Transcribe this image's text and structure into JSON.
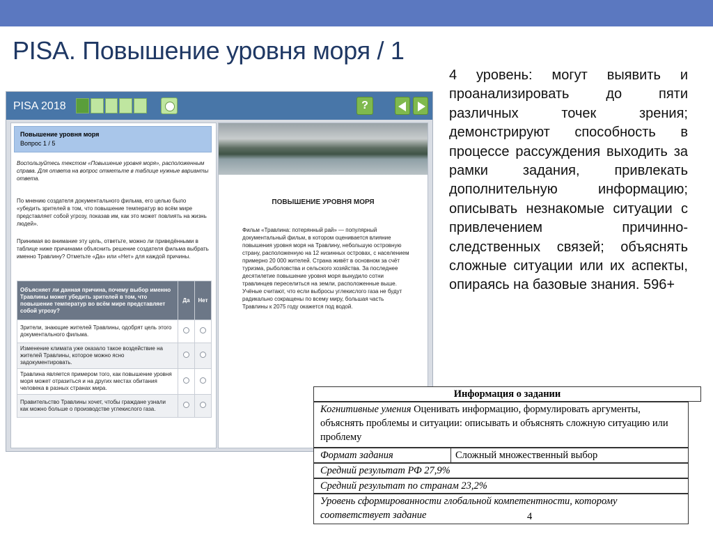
{
  "slide": {
    "title": "PISA. Повышение уровня моря / 1",
    "description": "4 уровень: могут выявить и проанализировать до пяти различных точек зрения; демонстрируют способность в процессе рассуждения выходить за рамки задания, привлекать дополнительную информацию; описывать незнакомые ситуации с привлечением причинно-следственных связей; объяснять  сложные ситуации или их аспекты, опираясь на базовые знания. 596+"
  },
  "pisa": {
    "logo": "PISA 2018",
    "help_label": "?",
    "progress": {
      "total": 5,
      "current": 1
    },
    "question_title": "Повышение уровня моря",
    "question_number": "Вопрос 1 / 5",
    "instruction": "Воспользуйтесь текстом «Повышение уровня моря», расположенным справа. Для ответа на вопрос отметьте в таблице нужные варианты ответа.",
    "paragraph1": "По мнению создателя документального фильма, его целью было «убедить зрителей в том, что повышение температур во всём мире представляет собой угрозу, показав им, как это может повлиять на жизнь людей».",
    "paragraph2": "Принимая во внимание эту цель, ответьте, можно ли приведёнными в таблице ниже причинами объяснить решение создателя фильма выбрать именно Травлину? Отметьте «Да» или «Нет» для каждой причины.",
    "table": {
      "header": "Объясняет ли данная причина, почему выбор именно Травлины может убедить зрителей в том, что повышение температур во всём мире представляет собой угрозу?",
      "col_yes": "Да",
      "col_no": "Нет",
      "rows": [
        "Зрители, знающие жителей Травлины, одобрят цель этого документального фильма.",
        "Изменение климата уже оказало такое воздействие на жителей Травлины, которое можно ясно задокументировать.",
        "Травлина является примером того, как повышение уровня моря может отразиться и на других местах обитания человека в разных странах мира.",
        "Правительство Травлины хочет, чтобы граждане узнали как можно больше о производстве углекислого газа."
      ]
    },
    "article_title": "ПОВЫШЕНИЕ УРОВНЯ МОРЯ",
    "article_text": "Фильм «Травлина: потерянный рай» — популярный документальный фильм, в котором оценивается влияние повышения уровня моря на Травлину, небольшую островную страну, расположенную на 12 низинных островах, с населением примерно 20 000 жителей. Страна живёт в основном за счёт туризма, рыболовства и сельского хозяйства. За последнее десятилетие повышение уровня моря вынудило сотни травлинцев переселиться на земли, расположенные выше. Учёные считают, что если выбросы углекислого газа не будут радикально сокращены по всему миру, большая часть Травлины к 2075 году окажется под водой."
  },
  "info": {
    "heading": "Информация о задании",
    "cognitive_label": "Когнитивные умения",
    "cognitive_value": " Оценивать информацию, формулировать аргументы, объяснять проблемы и ситуации: описывать и объяснять сложную ситуацию или проблему",
    "format_label": "Формат задания",
    "format_value": "Сложный множественный выбор",
    "avg_rf": "Средний результат РФ 27,9%",
    "avg_countries": "Средний результат по странам 23,2%",
    "level_label": "Уровень сформированности глобальной компетентности, которому соответствует задание",
    "level_value": "4"
  }
}
